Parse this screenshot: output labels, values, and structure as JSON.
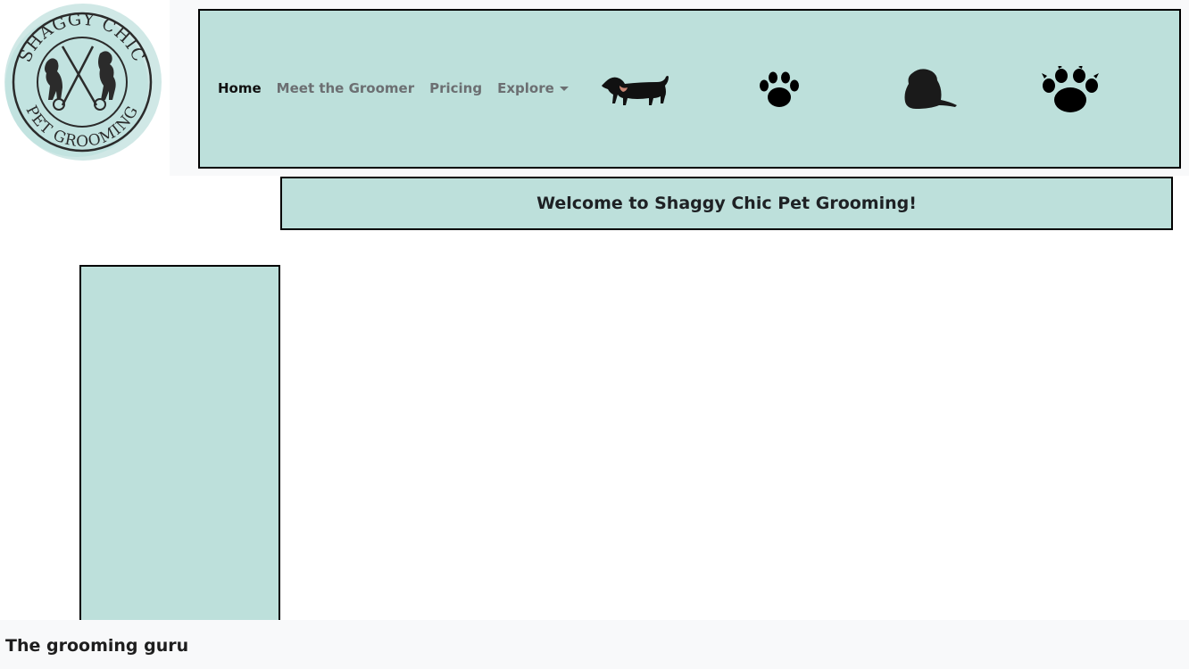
{
  "logo": {
    "text_top": "SHAGGY CHIC",
    "text_bottom": "PET GROOMING"
  },
  "nav": {
    "links": [
      {
        "label": "Home",
        "active": true
      },
      {
        "label": "Meet the Groomer",
        "active": false
      },
      {
        "label": "Pricing",
        "active": false
      },
      {
        "label": "Explore",
        "active": false,
        "dropdown": true
      }
    ],
    "icons": [
      "dachshund-icon",
      "paw-icon",
      "sitting-dog-icon",
      "paw-with-claws-icon"
    ]
  },
  "banner": {
    "title": "Welcome to Shaggy Chic Pet Grooming!"
  },
  "footer": {
    "text": "The grooming guru"
  },
  "colors": {
    "panel": "#bde0db",
    "border": "#000000",
    "header_bg": "#f8f9fa",
    "logo_wash": "#a9d6d2"
  }
}
